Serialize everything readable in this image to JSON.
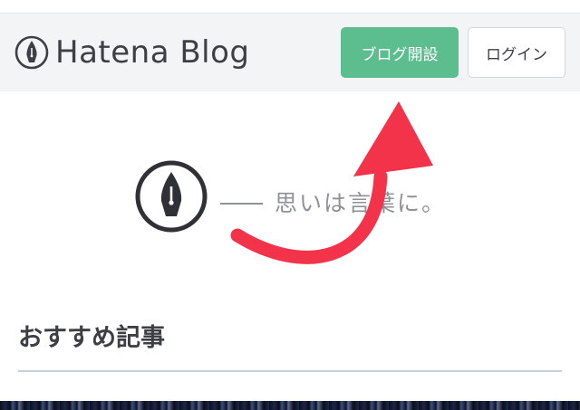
{
  "header": {
    "logo_icon": "fountain-pen-nib-icon",
    "logo_text": "Hatena Blog",
    "create_blog_label": "ブログ開設",
    "login_label": "ログイン"
  },
  "hero": {
    "icon": "fountain-pen-nib-icon",
    "tagline": "思いは言葉に。"
  },
  "annotation": {
    "icon": "curved-arrow-up-icon",
    "color": "#f2334a"
  },
  "section": {
    "title": "おすすめ記事"
  },
  "colors": {
    "accent_green": "#5cbd8e",
    "text_dark": "#3d3f44",
    "text_muted": "#8e9196",
    "header_bg": "#f3f4f6"
  }
}
